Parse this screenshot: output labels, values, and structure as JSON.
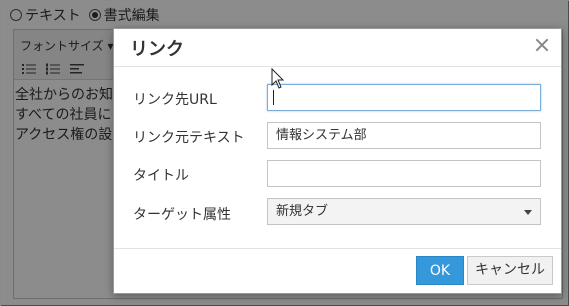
{
  "mode": {
    "options": [
      {
        "label": "テキスト",
        "selected": false
      },
      {
        "label": "書式編集",
        "selected": true
      }
    ]
  },
  "toolbar": {
    "font_size_label": "フォントサイズ ▾",
    "icons": [
      "bullet-list-icon",
      "numbered-list-icon",
      "align-left-icon"
    ]
  },
  "editor": {
    "lines": [
      "全社からのお知",
      "すべての社員に",
      "アクセス権の設"
    ]
  },
  "dialog": {
    "title": "リンク",
    "fields": {
      "url_label": "リンク先URL",
      "url_value": "",
      "text_label": "リンク元テキスト",
      "text_value": "情報システム部",
      "title_label": "タイトル",
      "title_value": "",
      "target_label": "ターゲット属性",
      "target_value": "新規タブ"
    },
    "ok_label": "OK",
    "cancel_label": "キャンセル"
  },
  "colors": {
    "ok_button": "#3498db",
    "overlay": "rgba(0,0,0,0.45)"
  }
}
